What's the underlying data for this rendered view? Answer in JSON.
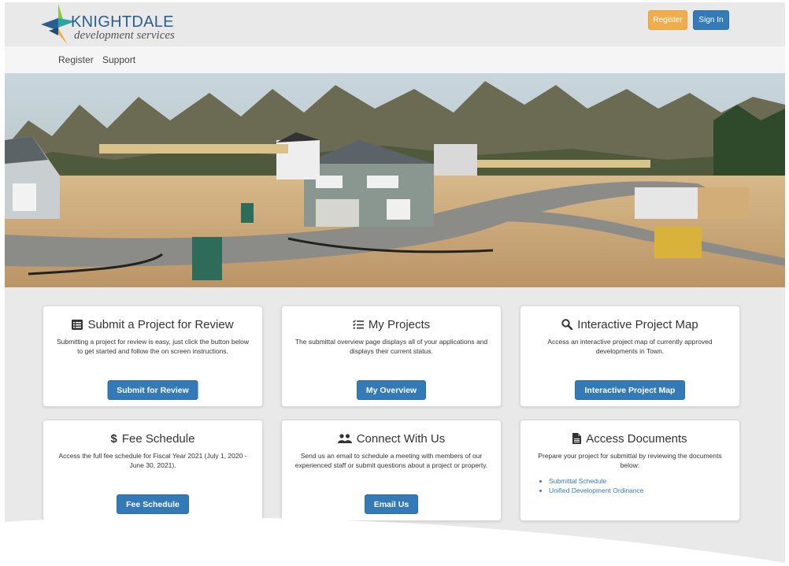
{
  "brand": {
    "name": "KNIGHTDALE",
    "tagline": "development services",
    "colors": {
      "blue": "#2a5f8f",
      "teal": "#2ea3a3",
      "green": "#8dc63f",
      "orange": "#f0ad4e",
      "primary": "#337ab7"
    }
  },
  "header": {
    "register_label": "Register",
    "signin_label": "Sign In"
  },
  "nav": {
    "items": [
      {
        "label": "Register"
      },
      {
        "label": "Support"
      }
    ]
  },
  "cards": [
    {
      "icon": "list-icon",
      "title": "Submit a Project for Review",
      "description": "Submitting a project for review is easy, just click the button below to get started and follow the on screen instructions.",
      "button": "Submit for Review"
    },
    {
      "icon": "tasks-icon",
      "title": "My Projects",
      "description": "The submittal overview page displays all of your applications and displays their current status.",
      "button": "My Overview"
    },
    {
      "icon": "search-icon",
      "title": "Interactive Project Map",
      "description": "Access an interactive project map of currently approved developments in Town.",
      "button": "Interactive Project Map"
    },
    {
      "icon": "dollar-icon",
      "title": "Fee Schedule",
      "description": "Access the full fee schedule for Fiscal Year 2021 (July 1, 2020 - June 30, 2021).",
      "button": "Fee Schedule"
    },
    {
      "icon": "users-icon",
      "title": "Connect With Us",
      "description": "Send us an email to schedule a meeting with members of our experienced staff or submit questions about a project or property.",
      "button": "Email Us"
    },
    {
      "icon": "file-icon",
      "title": "Access Documents",
      "description": "Prepare your project for submittal by reviewing the documents below:",
      "links": [
        "Submittal Schedule",
        "Unified Development Ordinance"
      ]
    }
  ]
}
